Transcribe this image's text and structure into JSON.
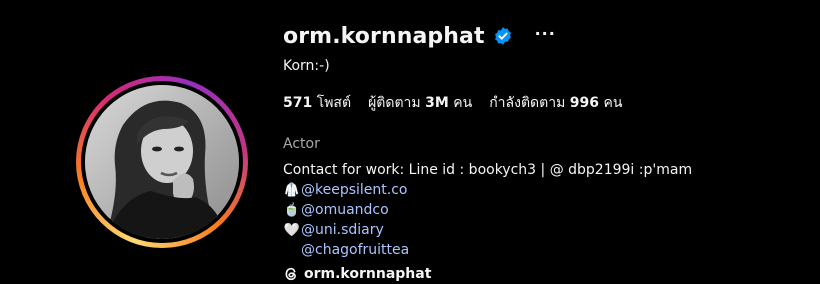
{
  "profile": {
    "username": "orm.kornnaphat",
    "full_name": "Korn:-)",
    "more_label": "···",
    "verified_icon": "verified-badge-icon",
    "verified_color": "#0095f6"
  },
  "stats": {
    "posts_count": "571",
    "posts_label": "โพสต์",
    "followers_label": "ผู้ติดตาม",
    "followers_count": "3M",
    "followers_unit": "คน",
    "following_label": "กำลังติดตาม",
    "following_count": "996",
    "following_unit": "คน"
  },
  "bio": {
    "category": "Actor",
    "contact": "Contact for work: Line id : bookych3 | @ dbp2199i :p'mam",
    "links": [
      {
        "emoji": "🥼",
        "text": "@keepsilent.co"
      },
      {
        "emoji": "🍵",
        "text": "@omuandco"
      },
      {
        "emoji": "🤍",
        "text": "@uni.sdiary"
      },
      {
        "emoji": "",
        "text": "@chagofruittea"
      }
    ]
  },
  "threads": {
    "icon": "threads-icon",
    "handle": "orm.kornnaphat"
  }
}
